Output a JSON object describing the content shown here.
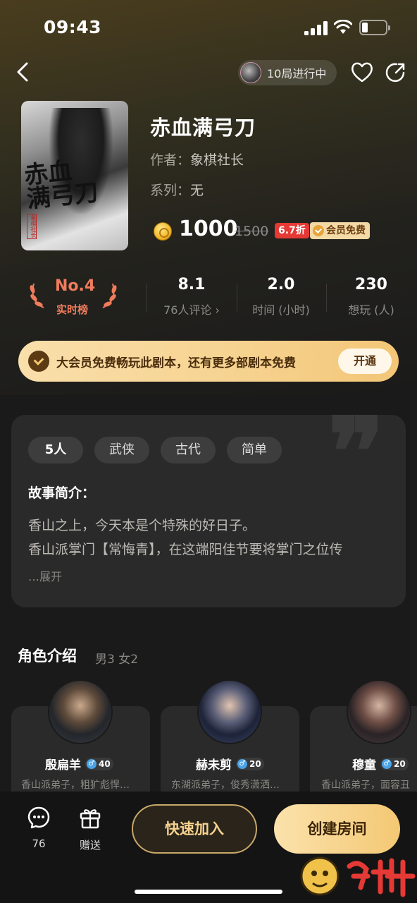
{
  "status_bar": {
    "time": "09:43"
  },
  "nav": {
    "progress_text": "10局进行中"
  },
  "script": {
    "title": "赤血满弓刀",
    "author_label": "作者：",
    "author": "象棋社长",
    "series_label": "系列：",
    "series": "无",
    "price": "1000",
    "old_price": "1500",
    "discount": "6.7折",
    "vip_free": "会员免费",
    "cover_calligraphy": "赤血满弓刀"
  },
  "stats": {
    "rank": "No.4",
    "rank_label": "实时榜",
    "items": [
      {
        "value": "8.1",
        "label": "76人评论 ›"
      },
      {
        "value": "2.0",
        "label": "时间 (小时)"
      },
      {
        "value": "230",
        "label": "想玩 (人)"
      }
    ]
  },
  "banner": {
    "text": "大会员免费畅玩此剧本，还有更多部剧本免费",
    "button": "开通"
  },
  "intro": {
    "tags": [
      "5人",
      "武侠",
      "古代",
      "简单"
    ],
    "heading": "故事简介：",
    "lines": [
      "香山之上，今天本是个特殊的好日子。",
      "香山派掌门【常悔青】，在这端阳佳节要将掌门之位传"
    ],
    "expand": "…展开"
  },
  "characters": {
    "title": "角色介绍",
    "summary": "男3 女2",
    "items": [
      {
        "name": "殷扁羊",
        "age": "40",
        "desc": "香山派弟子，粗犷彪悍…"
      },
      {
        "name": "赫未剪",
        "age": "20",
        "desc": "东湖派弟子，俊秀潇洒…"
      },
      {
        "name": "穆童",
        "age": "20",
        "desc": "香山派弟子，面容丑"
      }
    ]
  },
  "bottom": {
    "comments_count": "76",
    "gift_label": "赠送",
    "join_button": "快速加入",
    "create_button": "创建房间"
  },
  "colors": {
    "accent_gold": "#f6d28f",
    "rank_red": "#f07c5c",
    "discount_red": "#e53935"
  }
}
